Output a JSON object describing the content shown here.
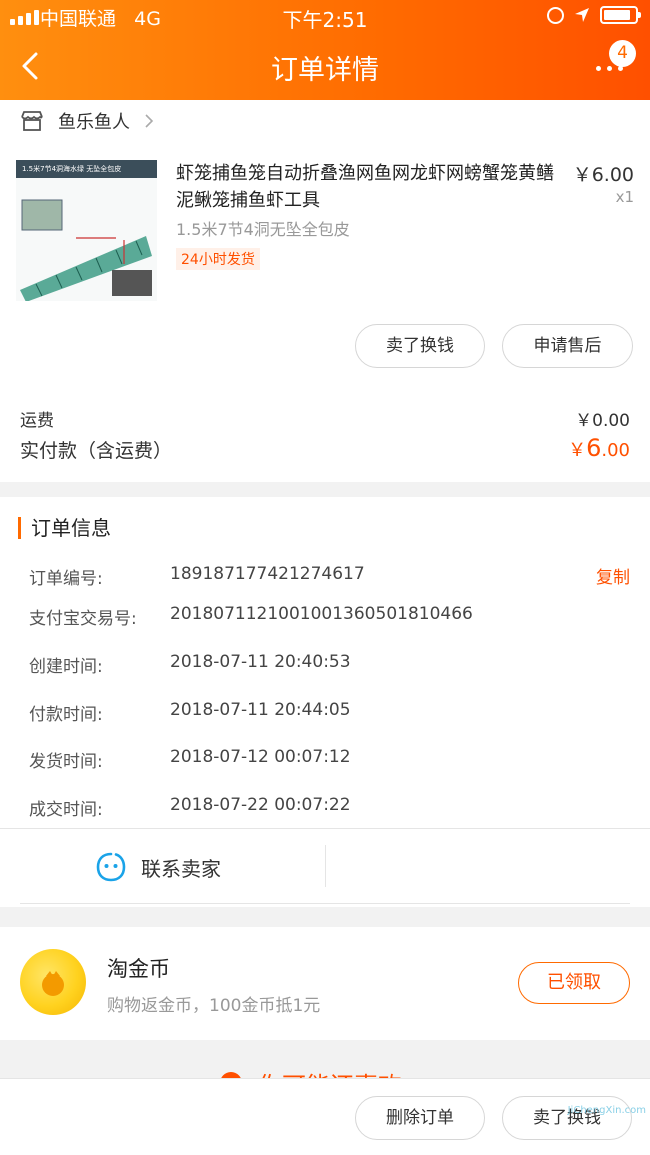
{
  "status_bar": {
    "carrier": "中国联通",
    "network": "4G",
    "time": "下午2:51"
  },
  "nav": {
    "title": "订单详情",
    "badge_count": "4"
  },
  "shop": {
    "name": "鱼乐鱼人"
  },
  "product": {
    "thumb_text": "1.5米7节4洞海水绿  无坠全包皮",
    "title": "虾笼捕鱼笼自动折叠渔网鱼网龙虾网螃蟹笼黄鳝泥鳅笼捕鱼虾工具",
    "price": "￥6.00",
    "qty": "x1",
    "sku": "1.5米7节4洞无坠全包皮",
    "tag": "24小时发货"
  },
  "actions": {
    "sell": "卖了换钱",
    "after_sale": "申请售后"
  },
  "fees": {
    "shipping_label": "运费",
    "shipping_value": "￥0.00",
    "paid_label": "实付款（含运费）",
    "paid_currency": "￥",
    "paid_int": "6",
    "paid_dec": ".00"
  },
  "order_info": {
    "title": "订单信息",
    "copy_label": "复制",
    "rows": [
      {
        "k": "订单编号:",
        "v": "189187177421274617"
      },
      {
        "k": "支付宝交易号:",
        "v": "2018071121001001360501810466"
      },
      {
        "k": "创建时间:",
        "v": "2018-07-11 20:40:53"
      },
      {
        "k": "付款时间:",
        "v": "2018-07-11 20:44:05"
      },
      {
        "k": "发货时间:",
        "v": "2018-07-12 00:07:12"
      },
      {
        "k": "成交时间:",
        "v": "2018-07-22 00:07:22"
      }
    ],
    "contact": "联系卖家"
  },
  "coins": {
    "title": "淘金币",
    "subtitle": "购物返金币，100金币抵1元",
    "button": "已领取"
  },
  "peek": {
    "text": "你可能还喜欢"
  },
  "bottom": {
    "delete": "删除订单",
    "sell": "卖了换钱"
  },
  "watermark": "JiChengXin.com",
  "colors": {
    "accent": "#ff5000",
    "header_start": "#ff8f0f",
    "header_end": "#ff5000"
  }
}
